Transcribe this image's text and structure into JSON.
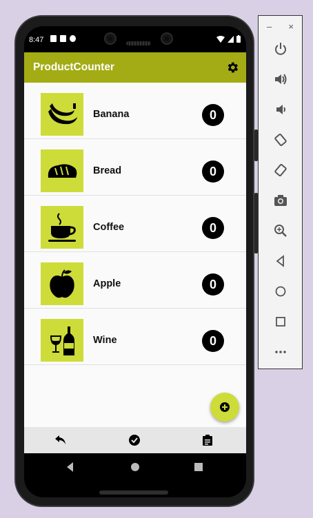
{
  "status_bar": {
    "time": "8:47"
  },
  "app_bar": {
    "title": "ProductCounter",
    "settings_icon": "gear-icon"
  },
  "products": [
    {
      "name": "Banana",
      "count": "0",
      "icon": "banana-icon"
    },
    {
      "name": "Bread",
      "count": "0",
      "icon": "bread-icon"
    },
    {
      "name": "Coffee",
      "count": "0",
      "icon": "coffee-icon"
    },
    {
      "name": "Apple",
      "count": "0",
      "icon": "apple-icon"
    },
    {
      "name": "Wine",
      "count": "0",
      "icon": "wine-icon"
    }
  ],
  "fab": {
    "icon": "add-circle-icon"
  },
  "bottom_bar": {
    "icons": [
      "undo-icon",
      "check-circle-icon",
      "clipboard-icon"
    ]
  },
  "nav_bar": {
    "icons": [
      "back-icon",
      "home-icon",
      "recents-icon"
    ]
  },
  "emulator": {
    "window_controls": {
      "minimize": "–",
      "close": "×"
    },
    "icons": [
      "power-icon",
      "volume-up-icon",
      "volume-down-icon",
      "rotate-left-icon",
      "rotate-right-icon",
      "camera-icon",
      "zoom-icon",
      "back-icon",
      "home-icon",
      "overview-icon",
      "more-icon"
    ]
  },
  "colors": {
    "app_bar": "#a3ac14",
    "thumb_bg": "#cddc39",
    "page_bg": "#d9d0e6"
  }
}
